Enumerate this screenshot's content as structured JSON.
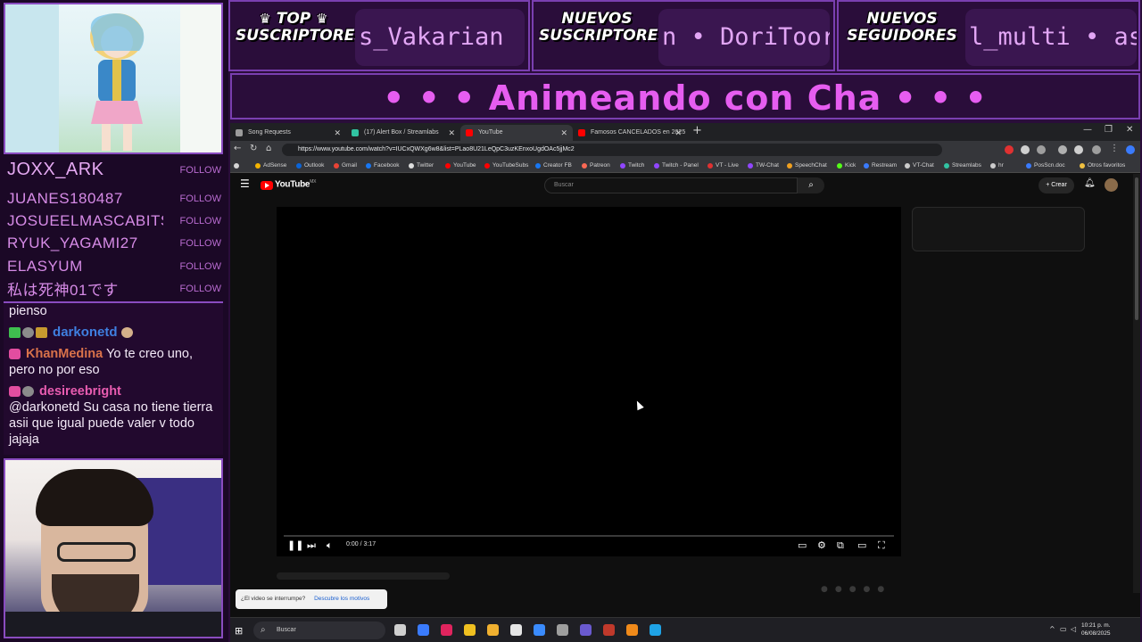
{
  "overlay": {
    "top_subs": {
      "title_line1": "TOP",
      "title_line2": "SUSCRIPTORES",
      "ticker": "s_Vakarian"
    },
    "new_subs": {
      "title_line1": "NUEVOS",
      "title_line2": "SUSCRIPTORES",
      "ticker": "n • DoriToor"
    },
    "new_followers": {
      "title_line1": "NUEVOS",
      "title_line2": "SEGUIDORES",
      "ticker": "l_multi • as"
    },
    "stream_title": "• • • Animeando con Cha • • •",
    "followers": [
      {
        "name": "JOXX_ARK",
        "tag": "FOLLOW"
      },
      {
        "name": "JUANES180487",
        "tag": "FOLLOW"
      },
      {
        "name": "JOSUEELMASCABITS",
        "tag": "FOLLOW"
      },
      {
        "name": "RYUK_YAGAMI27",
        "tag": "FOLLOW"
      },
      {
        "name": "ELASYUM",
        "tag": "FOLLOW"
      },
      {
        "name": "私は死神01です",
        "tag": "FOLLOW"
      }
    ],
    "chat": {
      "line0": "pienso",
      "msg1_user": "darkonetd",
      "msg2_user": "KhanMedina",
      "msg2_text": "Yo te creo uno, pero no por eso",
      "msg3_user": "desireebright",
      "msg3_text": "@darkonetd Su casa no tiene tierra asii que igual puede valer v todo jajaja"
    }
  },
  "browser": {
    "tabs": [
      {
        "label": "Song Requests",
        "color": "#9b9b9b"
      },
      {
        "label": "(17) Alert Box / Streamlabs",
        "color": "#31c3a2"
      },
      {
        "label": "YouTube",
        "color": "#ff0000"
      },
      {
        "label": "Famosos CANCELADOS en 2025",
        "color": "#ff0000"
      }
    ],
    "url": "https://www.youtube.com/watch?v=IUCxQWXg6w8&list=PLao8U21LeQpC3uzKEnxoUgdOAc5jjMc2",
    "bookmarks": [
      {
        "label": "AdSense",
        "color": "#f4b400"
      },
      {
        "label": "Outlook",
        "color": "#0a64d8"
      },
      {
        "label": "Gmail",
        "color": "#ea4335"
      },
      {
        "label": "Facebook",
        "color": "#1877f2"
      },
      {
        "label": "Twitter",
        "color": "#dddddd"
      },
      {
        "label": "YouTube",
        "color": "#ff0000"
      },
      {
        "label": "YouTubeSubs",
        "color": "#ff0000"
      },
      {
        "label": "Creator FB",
        "color": "#1877f2"
      },
      {
        "label": "Patreon",
        "color": "#f96854"
      },
      {
        "label": "Twitch",
        "color": "#9146ff"
      },
      {
        "label": "Twitch - Panel",
        "color": "#9146ff"
      },
      {
        "label": "VT - Live",
        "color": "#e03131"
      },
      {
        "label": "TW-Chat",
        "color": "#9146ff"
      },
      {
        "label": "SpeechChat",
        "color": "#f0a020"
      },
      {
        "label": "Kick",
        "color": "#53fc18"
      },
      {
        "label": "Restream",
        "color": "#3a7bfd"
      },
      {
        "label": "VT-Chat",
        "color": "#cccccc"
      },
      {
        "label": "Streamlabs",
        "color": "#31c3a2"
      },
      {
        "label": "hr",
        "color": "#cccccc"
      },
      {
        "label": "PosScn.doc",
        "color": "#3a7bfd"
      },
      {
        "label": "Otros favoritos",
        "color": "#f0c040"
      }
    ],
    "youtube": {
      "logo": "YouTube",
      "logo_sup": "MX",
      "search_placeholder": "Buscar",
      "create_label": "Crear",
      "time": "0:00 / 3:17",
      "progress_fraction": 0,
      "toast_text": "¿El video se interrumpe?",
      "toast_link": "Descubre los motivos"
    },
    "taskbar": {
      "search_label": "Buscar",
      "clock_time": "10:21 p. m.",
      "clock_date": "06/08/2025"
    }
  }
}
